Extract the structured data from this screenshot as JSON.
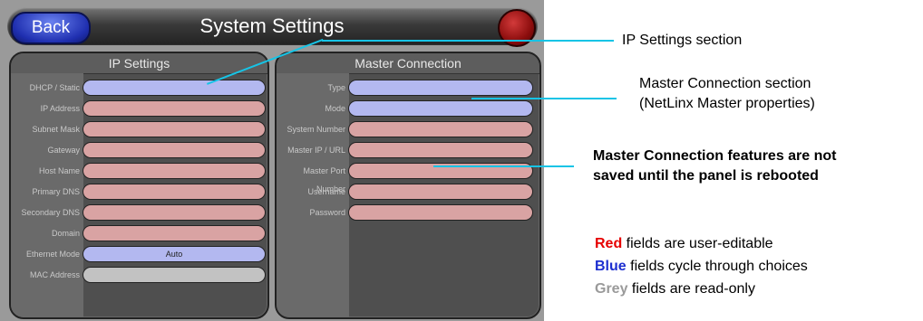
{
  "topbar": {
    "back_label": "Back",
    "title": "System Settings"
  },
  "ip_section": {
    "title": "IP Settings",
    "rows": [
      {
        "label": "DHCP / Static",
        "value": "",
        "kind": "blue"
      },
      {
        "label": "IP Address",
        "value": "",
        "kind": "red"
      },
      {
        "label": "Subnet Mask",
        "value": "",
        "kind": "red"
      },
      {
        "label": "Gateway",
        "value": "",
        "kind": "red"
      },
      {
        "label": "Host Name",
        "value": "",
        "kind": "red"
      },
      {
        "label": "Primary DNS",
        "value": "",
        "kind": "red"
      },
      {
        "label": "Secondary DNS",
        "value": "",
        "kind": "red"
      },
      {
        "label": "Domain",
        "value": "",
        "kind": "red"
      },
      {
        "label": "Ethernet Mode",
        "value": "Auto",
        "kind": "blue"
      },
      {
        "label": "MAC Address",
        "value": "",
        "kind": "grey"
      }
    ]
  },
  "master_section": {
    "title": "Master Connection",
    "rows": [
      {
        "label": "Type",
        "value": "",
        "kind": "blue"
      },
      {
        "label": "Mode",
        "value": "",
        "kind": "blue"
      },
      {
        "label": "System Number",
        "value": "",
        "kind": "red"
      },
      {
        "label": "Master IP / URL",
        "value": "",
        "kind": "red"
      },
      {
        "label": "Master Port Number",
        "value": "",
        "kind": "red"
      },
      {
        "label": "Username",
        "value": "",
        "kind": "red"
      },
      {
        "label": "Password",
        "value": "",
        "kind": "red"
      }
    ]
  },
  "callouts": {
    "ip": "IP Settings section",
    "master_line1": "Master Connection section",
    "master_line2": "(NetLinx Master properties)",
    "note_line1": "Master Connection features are not",
    "note_line2": "saved until the panel is rebooted"
  },
  "legend": {
    "red_word": "Red",
    "red_text": " fields are user-editable",
    "blue_word": "Blue",
    "blue_text": " fields cycle through choices",
    "grey_word": "Grey",
    "grey_text": " fields are read-only"
  },
  "colors": {
    "red": "#e60000",
    "blue": "#1d2fd0",
    "grey": "#9a9a9a",
    "callout_line": "#16c4e6"
  }
}
